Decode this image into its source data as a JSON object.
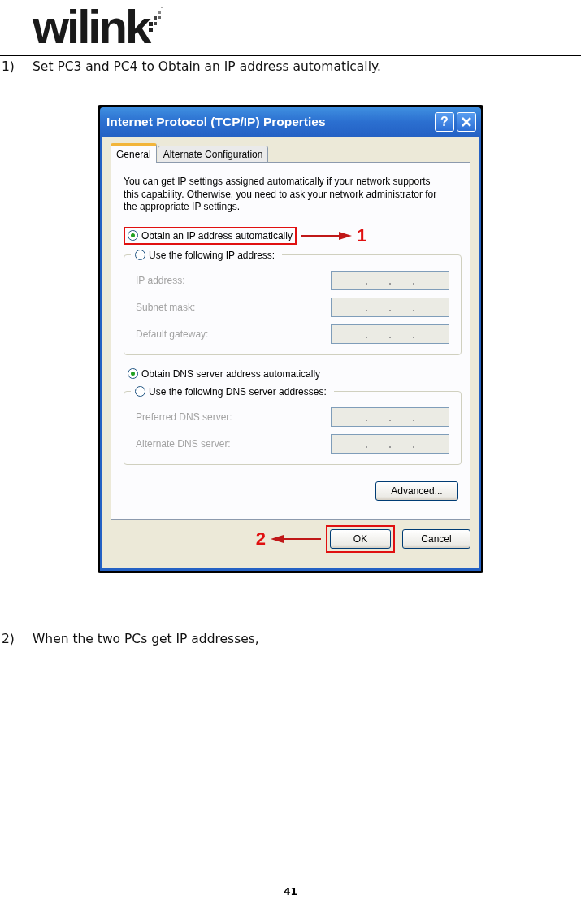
{
  "header": {
    "logo": "wilink"
  },
  "steps": [
    {
      "number": "1)",
      "text": "Set PC3 and PC4 to Obtain an IP address automatically."
    },
    {
      "number": "2)",
      "text": "When the two PCs get IP addresses,"
    }
  ],
  "dialog": {
    "title": "Internet Protocol (TCP/IP) Properties",
    "help": "?",
    "tabs": [
      {
        "label": "General",
        "selected": true
      },
      {
        "label": "Alternate Configuration",
        "selected": false
      }
    ],
    "intro": "You can get IP settings assigned automatically if your network supports this capability. Otherwise, you need to ask your network administrator for the appropriate IP settings.",
    "ip_auto": {
      "label": "Obtain an IP address automatically",
      "selected": true,
      "callout": "1"
    },
    "ip_manual": {
      "label": "Use the following IP address:",
      "selected": false
    },
    "ip_fields": [
      {
        "label": "IP address:",
        "disabled": true
      },
      {
        "label": "Subnet mask:",
        "disabled": true
      },
      {
        "label": "Default gateway:",
        "disabled": true
      }
    ],
    "dns_auto": {
      "label": "Obtain DNS server address automatically",
      "selected": true
    },
    "dns_manual": {
      "label": "Use the following DNS server addresses:",
      "selected": false
    },
    "dns_fields": [
      {
        "label": "Preferred DNS server:",
        "disabled": true
      },
      {
        "label": "Alternate DNS server:",
        "disabled": true
      }
    ],
    "advanced": "Advanced...",
    "ok": {
      "label": "OK",
      "callout": "2"
    },
    "cancel": "Cancel"
  },
  "page_number": "41"
}
